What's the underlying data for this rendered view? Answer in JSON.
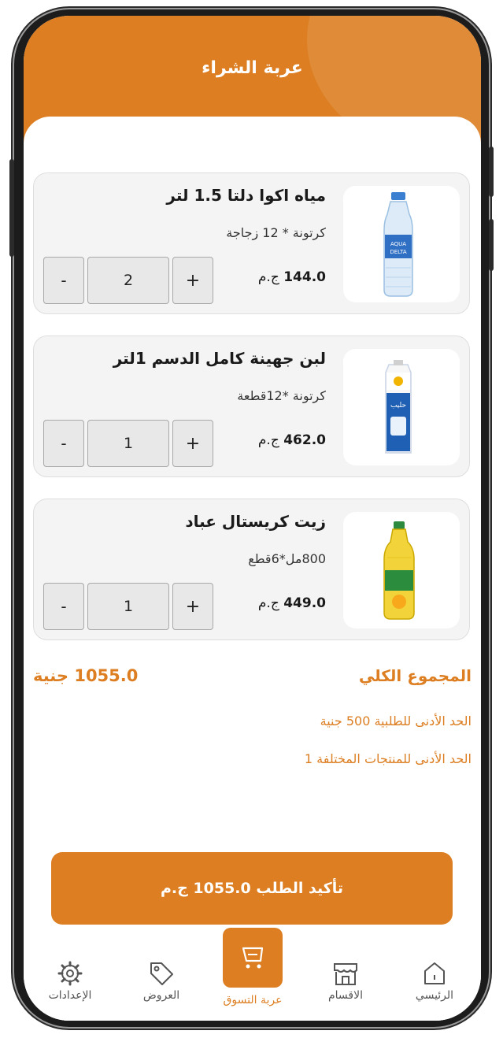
{
  "header": {
    "title": "عربة الشراء"
  },
  "cart": {
    "items": [
      {
        "name": "مياه اكوا دلتا 1.5 لتر",
        "pack": "كرتونة * 12 زجاجة",
        "price": "144.0",
        "currency": "ج.م",
        "qty": "2",
        "image": "water-bottle-image"
      },
      {
        "name": "لبن جهينة كامل الدسم 1لتر",
        "pack": "كرتونة *12قطعة",
        "price": "462.0",
        "currency": "ج.م",
        "qty": "1",
        "image": "milk-carton-image"
      },
      {
        "name": "زيت كريستال عباد",
        "pack": "800مل*6قطع",
        "price": "449.0",
        "currency": "ج.م",
        "qty": "1",
        "image": "oil-bottle-image"
      }
    ],
    "minus_label": "-",
    "plus_label": "+"
  },
  "totals": {
    "label": "المجموع الكلي",
    "value": "1055.0 جنية",
    "min_order": "الحد الأدنى للطلبية 500 جنية",
    "min_products": "الحد الأدنى للمنتجات المختلفة 1"
  },
  "confirm": {
    "label": "تأكيد الطلب 1055.0 ج.م"
  },
  "nav": {
    "items": [
      {
        "label": "الرئيسي",
        "icon": "home-icon"
      },
      {
        "label": "الاقسام",
        "icon": "store-icon"
      },
      {
        "label": "عربة التسوق",
        "icon": "cart-icon",
        "active": true
      },
      {
        "label": "العروض",
        "icon": "tag-icon"
      },
      {
        "label": "الإعدادات",
        "icon": "gear-icon"
      }
    ]
  },
  "colors": {
    "accent": "#dc7e21",
    "card_bg": "#f4f4f4",
    "stepper_bg": "#e8e8e8"
  }
}
